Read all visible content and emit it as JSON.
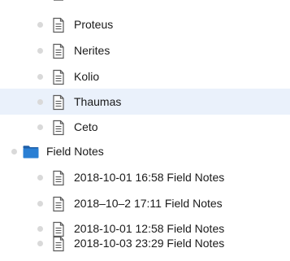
{
  "tree": {
    "documents_top": [
      {
        "label": "Proteus",
        "selected": false
      },
      {
        "label": "Nerites",
        "selected": false
      },
      {
        "label": "Kolio",
        "selected": false
      },
      {
        "label": "Thaumas",
        "selected": true
      },
      {
        "label": "Ceto",
        "selected": false
      }
    ],
    "folder": {
      "label": "Field Notes",
      "icon": "folder-icon"
    },
    "documents_field_notes": [
      {
        "label": "2018-10-01 16:58 Field Notes"
      },
      {
        "label": "2018–10–2 17:11 Field Notes"
      },
      {
        "label": "2018-10-01 12:58 Field Notes"
      },
      {
        "label": "2018-10-03 23:29 Field Notes"
      }
    ]
  },
  "colors": {
    "selection": "#eaf1fb",
    "folder_blue": "#2a7fd4",
    "bullet": "#d9d9d9",
    "doc_outline": "#5a5a5a"
  }
}
